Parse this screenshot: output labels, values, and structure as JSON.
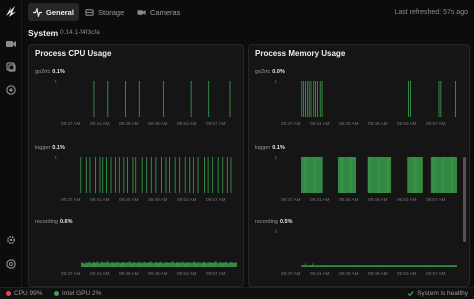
{
  "tabs": [
    {
      "label": "General",
      "icon": "activity-icon",
      "active": true
    },
    {
      "label": "Storage",
      "icon": "storage-icon",
      "active": false
    },
    {
      "label": "Cameras",
      "icon": "camera-icon",
      "active": false
    }
  ],
  "last_refreshed": "Last refreshed: 57s ago",
  "system": {
    "title": "System",
    "version": "0.14.1-f4f3cfa"
  },
  "panels": {
    "cpu": {
      "title": "Process CPU Usage"
    },
    "memory": {
      "title": "Process Memory Usage"
    }
  },
  "time_ticks": [
    "09:37 AM",
    "09:41 AM",
    "09:45 AM",
    "09:49 AM",
    "09:53 AM",
    "09:57 AM"
  ],
  "bar_color": "#3ba24e",
  "status": {
    "cpu": "CPU 99%",
    "gpu": "Intel GPU 2%",
    "health": "System is healthy",
    "cpu_color": "#e24b4b",
    "gpu_color": "#3ba24e",
    "health_color": "#3ba24e"
  },
  "chart_data": [
    {
      "type": "bar",
      "panel": "Process CPU Usage",
      "label": "go2rtc",
      "value_text": "0.1%",
      "ylim": [
        0,
        1
      ],
      "yticks": [
        "1"
      ],
      "values": [
        0,
        0,
        0,
        0,
        0,
        0,
        0,
        0,
        0,
        0,
        0,
        0,
        0,
        0,
        0,
        0,
        0,
        0,
        0,
        0,
        0,
        0,
        0,
        0,
        0,
        0,
        0,
        0,
        0,
        0,
        0,
        0,
        0,
        1,
        0,
        0,
        0,
        0,
        0,
        0,
        0,
        0,
        0,
        0,
        0,
        0,
        0,
        0,
        1,
        0,
        0,
        0,
        0,
        0,
        0,
        0,
        0,
        0,
        0,
        0,
        0,
        0,
        0,
        0,
        0,
        0,
        0,
        1,
        0,
        0,
        0,
        0,
        0,
        0,
        0,
        0,
        0,
        0,
        0,
        0,
        0,
        0,
        1,
        0,
        0,
        0,
        0,
        0,
        0,
        0,
        0,
        0,
        0,
        0,
        0,
        0,
        0,
        0,
        0,
        0,
        0,
        0,
        0,
        0,
        0,
        0,
        0,
        0,
        1,
        0,
        0,
        0,
        0,
        0,
        0,
        0,
        0,
        0,
        0,
        0,
        0,
        0,
        0,
        0,
        0,
        0,
        0,
        0,
        0,
        0,
        0,
        0,
        0,
        0,
        0,
        0,
        0,
        0,
        1,
        0,
        0,
        0,
        0,
        0,
        0,
        0,
        0,
        0,
        0,
        0,
        0,
        0,
        0,
        0,
        0,
        0,
        0,
        1,
        0,
        0,
        0,
        0,
        0,
        0,
        0,
        0,
        0,
        0,
        0,
        0,
        0,
        0,
        0,
        0,
        0,
        0,
        0,
        0,
        0,
        0,
        1,
        0,
        0,
        0,
        0,
        0,
        0,
        0
      ]
    },
    {
      "type": "bar",
      "panel": "Process CPU Usage",
      "label": "logger",
      "value_text": "0.1%",
      "ylim": [
        0,
        1
      ],
      "yticks": [
        "1"
      ],
      "values": [
        0,
        0,
        0,
        0,
        0,
        0,
        0,
        0,
        0,
        0,
        0,
        0,
        0,
        0,
        0,
        0,
        0,
        0,
        0,
        1,
        0,
        0,
        0,
        0,
        0,
        1,
        0,
        0,
        0,
        1,
        0,
        0,
        0,
        0,
        0,
        1,
        0,
        0,
        0,
        0,
        1,
        0,
        0,
        1,
        0,
        0,
        0,
        1,
        0,
        0,
        0,
        0,
        1,
        0,
        0,
        0,
        0,
        1,
        0,
        0,
        0,
        1,
        0,
        0,
        0,
        0,
        1,
        0,
        0,
        0,
        1,
        0,
        0,
        0,
        0,
        0,
        1,
        0,
        0,
        1,
        0,
        0,
        0,
        0,
        0,
        0,
        1,
        0,
        0,
        0,
        0,
        1,
        0,
        0,
        0,
        0,
        1,
        0,
        0,
        0,
        0,
        1,
        0,
        0,
        0,
        0,
        0,
        1,
        0,
        0,
        0,
        0,
        1,
        0,
        0,
        0,
        1,
        0,
        0,
        0,
        0,
        0,
        1,
        0,
        0,
        0,
        0,
        1,
        0,
        0,
        0,
        0,
        0,
        1,
        0,
        0,
        0,
        0,
        1,
        0,
        0,
        0,
        1,
        0,
        0,
        0,
        0,
        1,
        0,
        0,
        0,
        0,
        0,
        0,
        1,
        0,
        0,
        0,
        1,
        0,
        0,
        0,
        0,
        1,
        0,
        0,
        0,
        0,
        0,
        1,
        0,
        0,
        0,
        0,
        1,
        0,
        0,
        0,
        0,
        1,
        0,
        0,
        0,
        1,
        0,
        0,
        0,
        0,
        0,
        0
      ]
    },
    {
      "type": "bar",
      "panel": "Process CPU Usage",
      "label": "recording",
      "value_text": "0.6%",
      "ylim": [
        0,
        8
      ],
      "yticks": [],
      "values": [
        0,
        0,
        0,
        0,
        0,
        0,
        0,
        0,
        0,
        0,
        0,
        0,
        0,
        0,
        0,
        0,
        0,
        0,
        0,
        0,
        1,
        1,
        0.8,
        1,
        0.6,
        1,
        1,
        0.9,
        1,
        1.2,
        1,
        0.8,
        1,
        1,
        1.1,
        0.9,
        1,
        1,
        1.3,
        1,
        0.8,
        1,
        1,
        1.2,
        1,
        0.9,
        1,
        1,
        1,
        1.4,
        1,
        1,
        0.8,
        1,
        1.1,
        1,
        1,
        0.9,
        1,
        1,
        1.2,
        1,
        1,
        0.8,
        1,
        1,
        1.1,
        1,
        1,
        0.9,
        1,
        1,
        1,
        1.3,
        1,
        1,
        0.8,
        1,
        1.1,
        1,
        1,
        0.9,
        1,
        1,
        1.2,
        1,
        1,
        0.8,
        1,
        1,
        1.1,
        1,
        1,
        0.9,
        1,
        1,
        1,
        1.3,
        1,
        1,
        0.8,
        1,
        1.1,
        1,
        1,
        0.9,
        1,
        1,
        1.2,
        1,
        1,
        0.8,
        1,
        1,
        1.1,
        1,
        1,
        0.9,
        1,
        1,
        1,
        1.3,
        1,
        1,
        0.8,
        1,
        1.1,
        1,
        1,
        0.9,
        1,
        1,
        1.2,
        1,
        1,
        0.8,
        1,
        1,
        1.1,
        1,
        1,
        0.9,
        1,
        1,
        1,
        1.3,
        1,
        1,
        0.8,
        1,
        1.1,
        1,
        1,
        0.9,
        1,
        1,
        1.2,
        1,
        1,
        0.8,
        1,
        1,
        1.1,
        1,
        1,
        0.9,
        1,
        1,
        1,
        1.3,
        1,
        1,
        0.8,
        1,
        1.1,
        1,
        1,
        0.9,
        1,
        1,
        1.2,
        1,
        1,
        0.8,
        1,
        1,
        1.1,
        1,
        1,
        0.9,
        1,
        1,
        1
      ]
    },
    {
      "type": "bar",
      "panel": "Process Memory Usage",
      "label": "go2rtc",
      "value_text": "0.0%",
      "ylim": [
        0,
        1
      ],
      "yticks": [
        "1"
      ],
      "values": [
        0,
        0,
        0,
        0,
        0,
        0,
        0,
        0,
        0,
        0,
        0,
        0,
        0,
        0,
        0,
        0,
        0,
        0,
        0,
        0,
        1,
        0,
        1,
        0,
        1,
        0,
        1,
        0,
        1,
        0,
        1,
        0,
        0,
        1,
        0,
        1,
        0,
        1,
        0,
        0,
        1,
        0,
        1,
        0,
        0,
        0,
        0,
        0,
        0,
        0,
        0,
        0,
        0,
        0,
        0,
        0,
        0,
        0,
        0,
        0,
        0,
        0,
        0,
        0,
        0,
        0,
        0,
        0,
        0,
        0,
        0,
        0,
        0,
        0,
        0,
        0,
        0,
        0,
        0,
        0,
        0,
        0,
        0,
        0,
        0,
        0,
        0,
        0,
        0,
        0,
        0,
        0,
        0,
        0,
        0,
        0,
        0,
        0,
        0,
        0,
        0,
        0,
        0,
        0,
        0,
        0,
        0,
        0,
        0,
        0,
        0,
        0,
        0,
        0,
        0,
        0,
        0,
        0,
        0,
        0,
        0,
        0,
        0,
        0,
        0,
        0,
        0,
        0,
        0,
        0,
        0,
        0,
        0,
        0,
        0,
        0,
        1,
        0,
        1,
        0,
        0,
        0,
        0,
        0,
        0,
        0,
        0,
        0,
        0,
        0,
        0,
        0,
        0,
        0,
        0,
        0,
        0,
        0,
        0,
        0,
        0,
        0,
        0,
        0,
        0,
        0,
        0,
        0,
        0,
        1,
        0,
        1,
        0,
        0,
        0,
        0,
        0,
        0,
        0,
        0,
        0,
        0,
        0,
        0,
        0,
        0,
        0,
        1,
        0
      ]
    },
    {
      "type": "bar",
      "panel": "Process Memory Usage",
      "label": "logger",
      "value_text": "0.1%",
      "ylim": [
        0,
        1
      ],
      "yticks": [
        "1"
      ],
      "values": [
        0,
        0,
        0,
        0,
        0,
        0,
        0,
        0,
        0,
        0,
        0,
        0,
        0,
        0,
        0,
        0,
        0,
        0,
        0,
        0,
        1,
        1,
        1,
        1,
        1,
        1,
        1,
        1,
        1,
        1,
        1,
        1,
        1,
        1,
        1,
        1,
        1,
        1,
        1,
        1,
        1,
        1,
        1,
        1,
        0,
        0,
        0,
        0,
        0,
        0,
        0,
        0,
        0,
        0,
        0,
        0,
        0,
        0,
        0,
        0,
        0,
        1,
        1,
        1,
        1,
        1,
        1,
        1,
        1,
        1,
        1,
        1,
        1,
        1,
        1,
        1,
        1,
        1,
        1,
        1,
        1,
        0,
        0,
        0,
        0,
        0,
        0,
        0,
        0,
        0,
        0,
        0,
        0,
        0,
        1,
        1,
        1,
        1,
        1,
        1,
        1,
        1,
        1,
        1,
        1,
        1,
        1,
        1,
        1,
        1,
        1,
        1,
        1,
        1,
        1,
        1,
        1,
        1,
        1,
        1,
        0,
        0,
        0,
        0,
        0,
        0,
        0,
        0,
        0,
        0,
        0,
        0,
        0,
        0,
        0,
        0,
        0,
        0,
        1,
        1,
        1,
        1,
        1,
        1,
        1,
        1,
        1,
        1,
        1,
        1,
        1,
        1,
        1,
        1,
        1,
        0,
        0,
        0,
        0,
        0,
        0,
        0,
        0,
        0,
        1,
        1,
        1,
        1,
        1,
        1,
        1,
        1,
        1,
        1,
        1,
        1,
        1,
        1,
        1,
        1,
        1,
        1,
        1,
        1,
        1,
        1,
        1,
        1,
        1,
        1,
        1,
        1,
        1
      ]
    },
    {
      "type": "bar",
      "panel": "Process Memory Usage",
      "label": "recording",
      "value_text": "0.5%",
      "ylim": [
        0,
        2
      ],
      "yticks": [
        "2"
      ],
      "values": [
        0,
        0,
        0,
        0,
        0,
        0,
        0,
        0,
        0,
        0,
        0,
        0,
        0,
        0,
        0,
        0,
        0,
        0,
        0,
        0,
        0.1,
        0.1,
        0.1,
        0.1,
        0.2,
        0.1,
        0.1,
        0.1,
        0.1,
        0.1,
        0.1,
        0.1,
        0.2,
        0.1,
        0.1,
        0.1,
        0.1,
        0.1,
        0.1,
        0.1,
        0.1,
        0.1,
        0.1,
        0.1,
        0.1,
        0.1,
        0.1,
        0.1,
        0.1,
        0.1,
        0.1,
        0.1,
        0.1,
        0.1,
        0.1,
        0.1,
        0.1,
        0.1,
        0.1,
        0.1,
        0.1,
        0.1,
        0.1,
        0.1,
        0.1,
        0.1,
        0.1,
        0.1,
        0.1,
        0.1,
        0.1,
        0.1,
        0.1,
        0.1,
        0.1,
        0.1,
        0.1,
        0.1,
        0.1,
        0.1,
        0.1,
        0.1,
        0.1,
        0.1,
        0.1,
        0.1,
        0.1,
        0.1,
        0.1,
        0.1,
        0.1,
        0.1,
        0.1,
        0.1,
        0.1,
        0.1,
        0.1,
        0.1,
        0.1,
        0.1,
        0.1,
        0.1,
        0.1,
        0.1,
        0.1,
        0.1,
        0.1,
        0.1,
        0.1,
        0.1,
        0.1,
        0.1,
        0.1,
        0.1,
        0.1,
        0.1,
        0.1,
        0.1,
        0.1,
        0.1,
        0.1,
        0.1,
        0.1,
        0.1,
        0.1,
        0.1,
        0.1,
        0.1,
        0.1,
        0.1,
        0.1,
        0.1,
        0.1,
        0.1,
        0.1,
        0.1,
        0.1,
        0.1,
        0.1,
        0.1,
        0.1,
        0.1,
        0.1,
        0.1,
        0.1,
        0.1,
        0.1,
        0.1,
        0.1,
        0.1,
        0.1,
        0.1,
        0.1,
        0.1,
        0.1,
        0.1,
        0.1,
        0.1,
        0.1,
        0.1,
        0.1,
        0.1,
        0.1,
        0.1,
        0.1,
        0.1,
        0.1,
        0.1,
        0.1,
        0.1,
        0.1,
        0.1,
        0.1,
        0.1,
        0.1,
        0.1,
        0.1,
        0.1,
        0.1,
        0.1,
        0.1,
        0.1,
        0.1,
        0.1,
        0.1,
        0.1,
        0.1,
        0.1,
        0.1
      ]
    }
  ]
}
